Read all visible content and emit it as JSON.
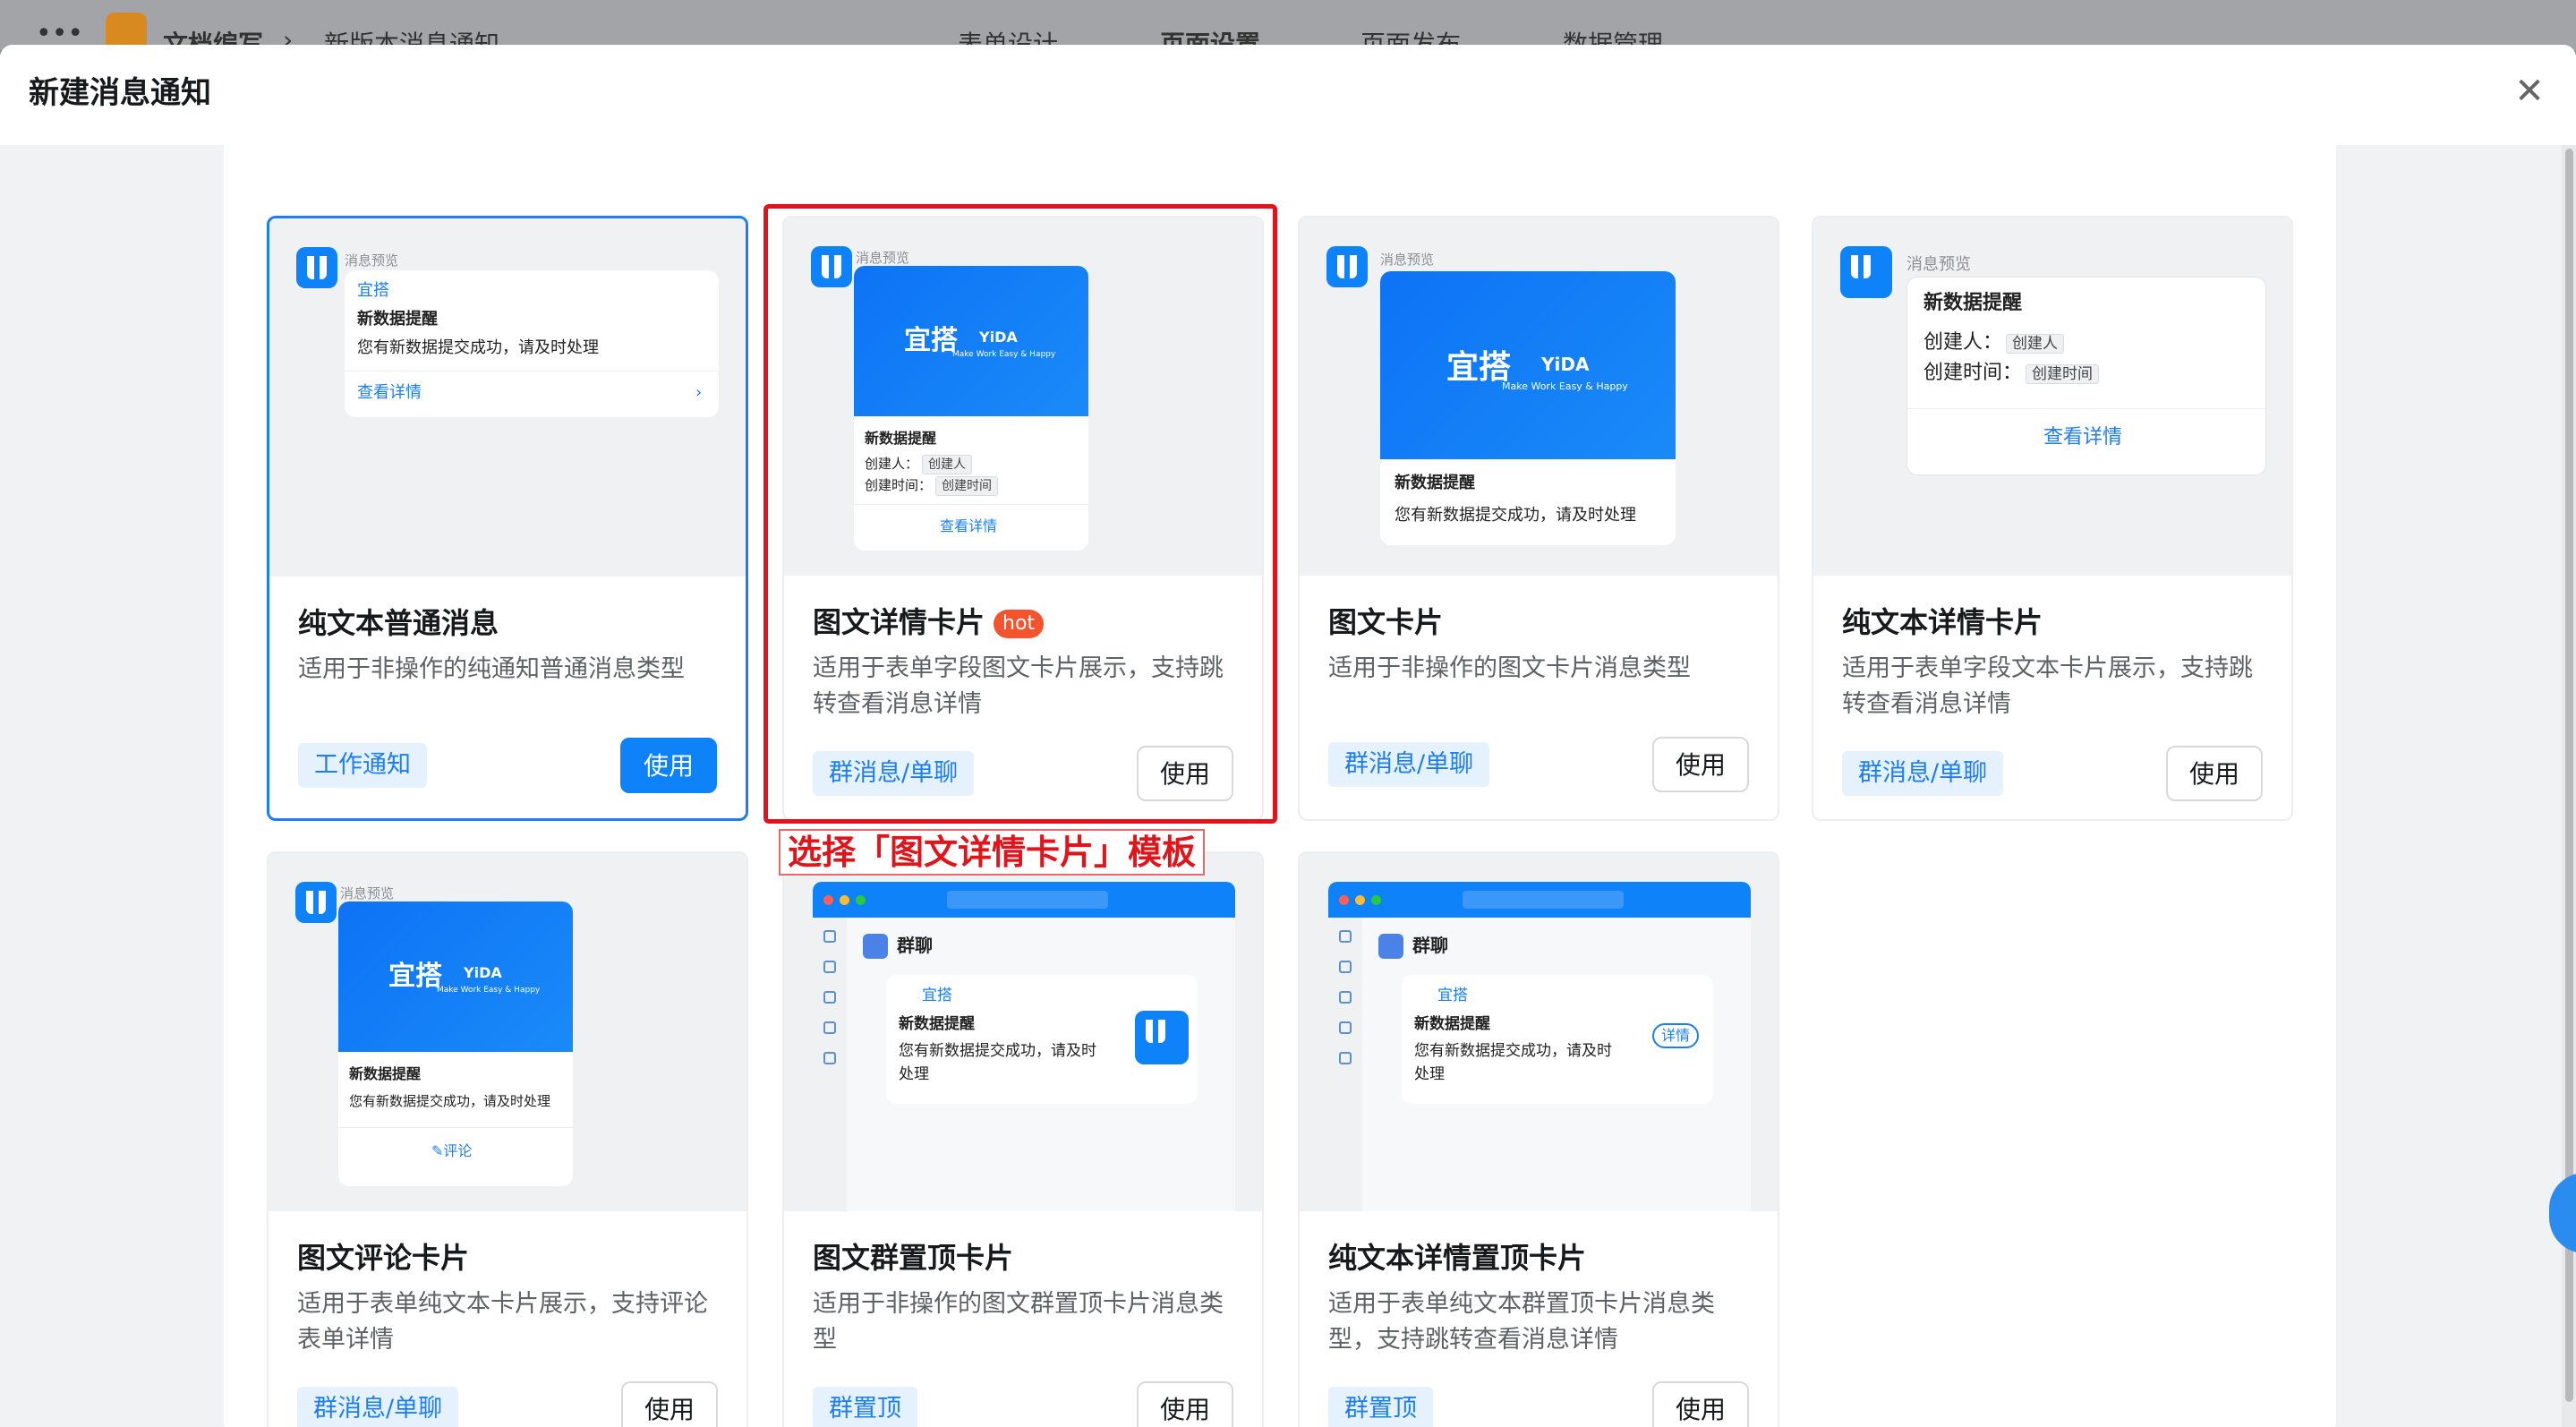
{
  "background_app": {
    "crumbs": [
      "文档编写",
      "新版本消息通知"
    ],
    "tabs": [
      "表单设计",
      "页面设置",
      "页面发布",
      "数据管理"
    ]
  },
  "modal": {
    "title": "新建消息通知",
    "close_icon": "close-icon"
  },
  "annotation": {
    "note": "选择「图文详情卡片」模板"
  },
  "preview_common": {
    "preview_label": "消息预览",
    "brand": "宜搭",
    "brand_en": "YiDA",
    "slogan": "Make Work Easy & Happy",
    "msg_title": "新数据提醒",
    "msg_body": "您有新数据提交成功，请及时处理",
    "msg_body_wrap": "您有新数据提交成功，请及时",
    "msg_body_wrap2": "处理",
    "creator_label": "创建人：",
    "creator_chip": "创建人",
    "time_label": "创建时间：",
    "time_chip": "创建时间",
    "view_detail": "查看详情",
    "comment": "评论",
    "group_chat": "群聊",
    "detail_pill": "详情"
  },
  "cards": [
    {
      "title": "纯文本普通消息",
      "desc": "适用于非操作的纯通知普通消息类型",
      "tag": "工作通知",
      "action": "使用"
    },
    {
      "title": "图文详情卡片",
      "badge": "hot",
      "desc": "适用于表单字段图文卡片展示，支持跳转查看消息详情",
      "tag": "群消息/单聊",
      "action": "使用"
    },
    {
      "title": "图文卡片",
      "desc": "适用于非操作的图文卡片消息类型",
      "tag": "群消息/单聊",
      "action": "使用"
    },
    {
      "title": "纯文本详情卡片",
      "desc": "适用于表单字段文本卡片展示，支持跳转查看消息详情",
      "tag": "群消息/单聊",
      "action": "使用"
    },
    {
      "title": "图文评论卡片",
      "desc": "适用于表单纯文本卡片展示，支持评论表单详情",
      "tag": "群消息/单聊",
      "action": "使用"
    },
    {
      "title": "图文群置顶卡片",
      "desc": "适用于非操作的图文群置顶卡片消息类型",
      "tag": "群置顶",
      "action": "使用"
    },
    {
      "title": "纯文本详情置顶卡片",
      "desc": "适用于表单纯文本群置顶卡片消息类型，支持跳转查看消息详情",
      "tag": "群置顶",
      "action": "使用"
    }
  ],
  "colors": {
    "primary": "#0e82f8",
    "highlight": "#e0141a",
    "hot": "#f5532d"
  }
}
